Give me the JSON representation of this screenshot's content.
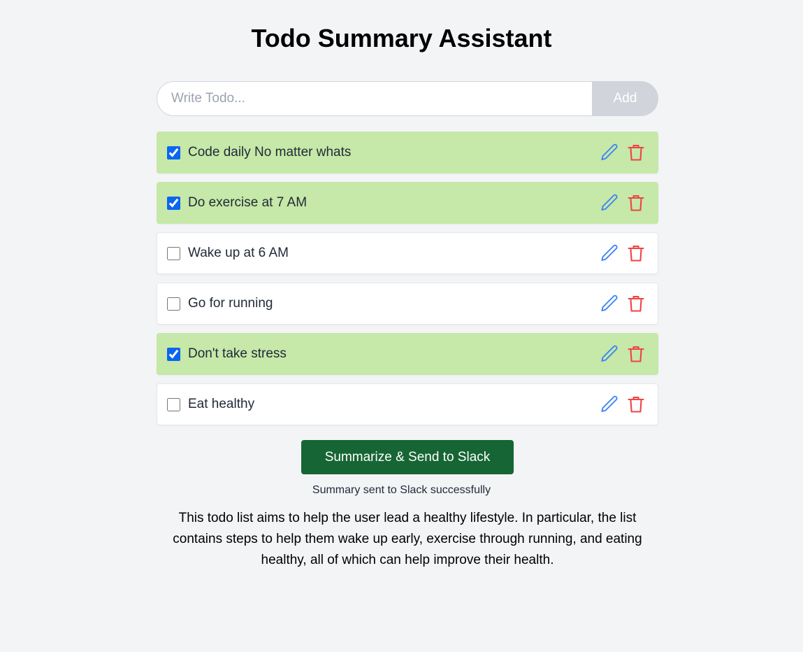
{
  "title": "Todo Summary Assistant",
  "input": {
    "value": "",
    "placeholder": "Write Todo...",
    "add_label": "Add"
  },
  "todos": [
    {
      "text": "Code daily No matter whats",
      "completed": true
    },
    {
      "text": "Do exercise at 7 AM",
      "completed": true
    },
    {
      "text": "Wake up at 6 AM",
      "completed": false
    },
    {
      "text": "Go for running",
      "completed": false
    },
    {
      "text": "Don't take stress",
      "completed": true
    },
    {
      "text": "Eat healthy",
      "completed": false
    }
  ],
  "icons": {
    "edit": "pencil-icon",
    "delete": "trash-icon"
  },
  "colors": {
    "completed_bg": "#c6e8a8",
    "edit": "#3b82f6",
    "delete": "#ef4444",
    "summarize_button": "#166534"
  },
  "summarize_label": "Summarize & Send to Slack",
  "status": "Summary sent to Slack successfully",
  "summary": "This todo list aims to help the user lead a healthy lifestyle. In particular, the list contains steps to help them wake up early, exercise through running, and eating healthy, all of which can help improve their health."
}
